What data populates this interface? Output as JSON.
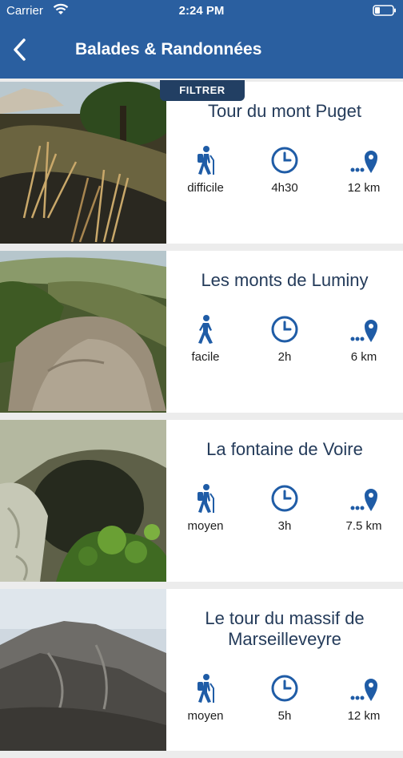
{
  "status": {
    "carrier": "Carrier",
    "time": "2:24 PM"
  },
  "header": {
    "title": "Balades & Randonnées",
    "filter_label": "FILTRER"
  },
  "colors": {
    "brand": "#2a5fa0",
    "filter": "#223f63",
    "icon": "#1f5ca6"
  },
  "hikes": [
    {
      "title": "Tour du mont Puget",
      "difficulty": "difficile",
      "duration": "4h30",
      "distance": "12 km",
      "hiker_icon": "hiker-with-backpack-icon"
    },
    {
      "title": "Les monts de Luminy",
      "difficulty": "facile",
      "duration": "2h",
      "distance": "6 km",
      "hiker_icon": "walker-icon"
    },
    {
      "title": "La fontaine de Voire",
      "difficulty": "moyen",
      "duration": "3h",
      "distance": "7.5 km",
      "hiker_icon": "hiker-with-backpack-icon"
    },
    {
      "title": "Le tour du massif de Marseilleveyre",
      "difficulty": "moyen",
      "duration": "5h",
      "distance": "12 km",
      "hiker_icon": "hiker-with-backpack-icon"
    }
  ]
}
